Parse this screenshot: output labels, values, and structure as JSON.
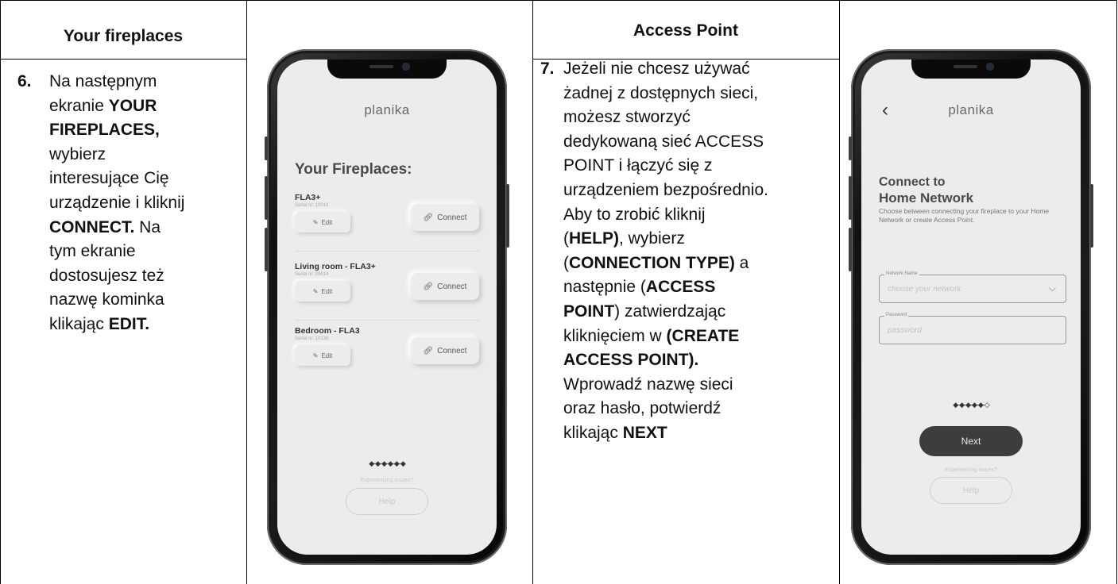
{
  "columns": {
    "left": {
      "heading": "Your fireplaces",
      "step_number": "6.",
      "lines": [
        [
          "Na następnym",
          ""
        ],
        [
          "ekranie ",
          "YOUR"
        ],
        [
          "",
          "FIREPLACES,"
        ],
        [
          "wybierz",
          ""
        ],
        [
          "interesujące Cię",
          ""
        ],
        [
          "urządzenie i kliknij",
          ""
        ],
        [
          "",
          "CONNECT.",
          " Na"
        ],
        [
          "tym ekranie",
          ""
        ],
        [
          "dostosujesz też",
          ""
        ],
        [
          "nazwę kominka",
          ""
        ],
        [
          "klikając ",
          "EDIT."
        ]
      ]
    },
    "right": {
      "heading": "Access Point",
      "step_number": "7.",
      "lines": [
        [
          "Jeżeli nie chcesz używać",
          ""
        ],
        [
          "żadnej z dostępnych sieci,",
          ""
        ],
        [
          "możesz stworzyć",
          ""
        ],
        [
          "dedykowaną sieć ACCESS",
          ""
        ],
        [
          "POINT i łączyć się z",
          ""
        ],
        [
          "urządzeniem bezpośrednio.",
          ""
        ],
        [
          "Aby to zrobić kliknij",
          ""
        ],
        [
          "(",
          "HELP)",
          ", wybierz"
        ],
        [
          "(",
          "CONNECTION TYPE)",
          " a"
        ],
        [
          "następnie (",
          "ACCESS"
        ],
        [
          "",
          "POINT",
          ") zatwierdzając"
        ],
        [
          "kliknięciem w ",
          "(CREATE"
        ],
        [
          "",
          "ACCESS POINT)."
        ],
        [
          "Wprowadź nazwę sieci",
          ""
        ],
        [
          "oraz hasło, potwierdź",
          ""
        ],
        [
          "klikając ",
          "NEXT"
        ]
      ]
    }
  },
  "phone1": {
    "logo": "planika",
    "title": "Your Fireplaces:",
    "fireplaces": [
      {
        "name": "FLA3+",
        "serial": "Serial nr: 10010",
        "edit": "Edit",
        "connect": "Connect"
      },
      {
        "name": "Living room - FLA3+",
        "serial": "Serial nr: 09614",
        "edit": "Edit",
        "connect": "Connect"
      },
      {
        "name": "Bedroom - FLA3",
        "serial": "Serial nr: 10138",
        "edit": "Edit",
        "connect": "Connect"
      }
    ],
    "progress": "◆-◆-◆-◆-◆-◆",
    "issues": "Experiencing issues?",
    "help": "Help"
  },
  "phone2": {
    "logo": "planika",
    "back": "‹",
    "title_line1": "Connect to",
    "title_line2": "Home Network",
    "subtitle": "Choose between connecting your fireplace to your Home Network or create Access Point.",
    "network_label": "Network Name",
    "network_placeholder": "choose your network",
    "password_label": "Password",
    "password_placeholder": "password",
    "progress": "◆-◆-◆-◆-◆-◇",
    "next": "Next",
    "issues": "Experiencing issues?",
    "help": "Help"
  }
}
